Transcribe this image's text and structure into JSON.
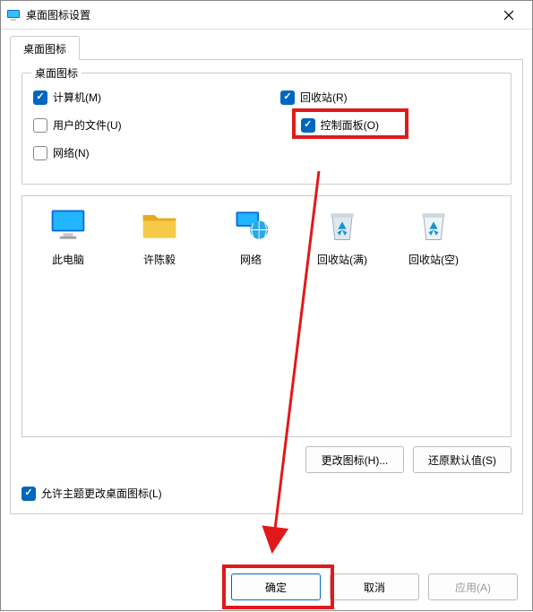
{
  "window": {
    "title": "桌面图标设置"
  },
  "tabs": {
    "main": "桌面图标"
  },
  "group": {
    "legend": "桌面图标",
    "computer": {
      "label": "计算机(M)",
      "checked": true
    },
    "recycle": {
      "label": "回收站(R)",
      "checked": true
    },
    "userfiles": {
      "label": "用户的文件(U)",
      "checked": false
    },
    "controlpanel": {
      "label": "控制面板(O)",
      "checked": true
    },
    "network": {
      "label": "网络(N)",
      "checked": false
    }
  },
  "preview": {
    "thispc": "此电脑",
    "user": "许陈毅",
    "network": "网络",
    "bin_full": "回收站(满)",
    "bin_empty": "回收站(空)"
  },
  "buttons": {
    "change_icon": "更改图标(H)...",
    "restore": "还原默认值(S)",
    "ok": "确定",
    "cancel": "取消",
    "apply": "应用(A)"
  },
  "allow_theme": {
    "label": "允许主题更改桌面图标(L)",
    "checked": true
  }
}
